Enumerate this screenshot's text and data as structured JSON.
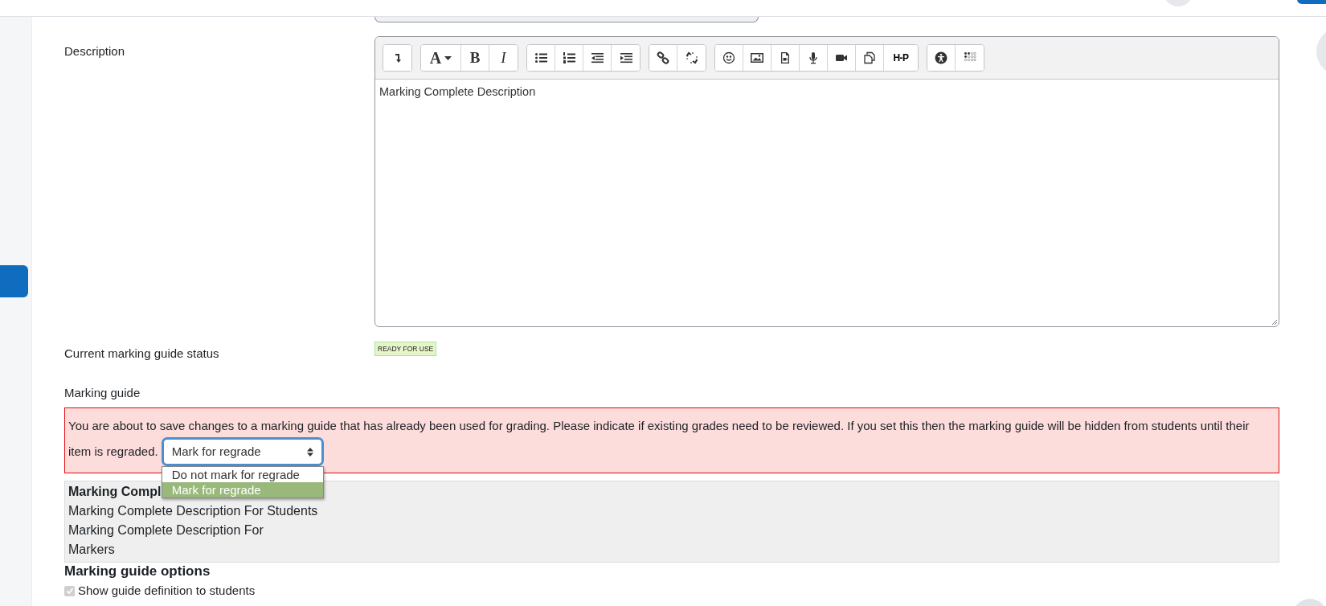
{
  "description": {
    "label": "Description",
    "toolbar_text": [
      "A",
      "B",
      "I",
      "H-P"
    ],
    "content": "Marking Complete Description"
  },
  "status": {
    "label": "Current marking guide status",
    "badge": "READY FOR USE"
  },
  "marking_guide": {
    "label": "Marking guide",
    "warning_lines": [
      "You are about to save changes to a marking guide that has already been used for grading. Please indicate if existing grades need to be reviewed. If you set this then the marking guide will be hidden from students until their",
      "item is regraded."
    ],
    "regrade_select": {
      "value": "Mark for regrade",
      "expanded": true,
      "options": [
        {
          "label": "Do not mark for regrade",
          "selected": false
        },
        {
          "label": "Mark for regrade",
          "selected": true
        }
      ]
    }
  },
  "criterion": {
    "name": "Marking Compl",
    "description_students": "Marking Complete Description For Students",
    "description_markers": "Marking Complete Description For Markers"
  },
  "options": {
    "heading": "Marking guide options",
    "items": [
      {
        "label": "Show guide definition to students",
        "checked": true,
        "disabled": true
      }
    ]
  }
}
